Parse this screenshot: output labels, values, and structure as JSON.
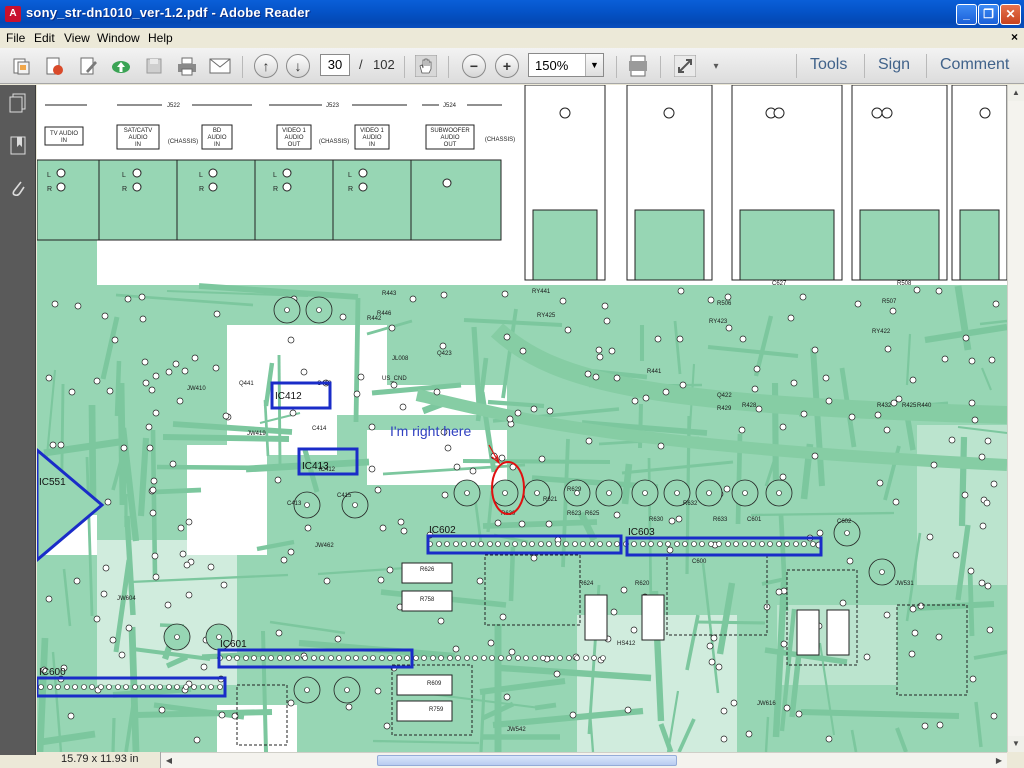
{
  "window": {
    "title": "sony_str-dn1010_ver-1.2.pdf - Adobe Reader",
    "app_icon": "adobe-pdf-icon",
    "minimize": "_",
    "maximize": "❐",
    "close": "✕"
  },
  "menu": {
    "items": [
      "File",
      "Edit",
      "View",
      "Window",
      "Help"
    ],
    "close_glyph": "×"
  },
  "toolbar": {
    "page_current": "30",
    "page_separator": "/",
    "page_total": "102",
    "zoom": "150%",
    "tools_label": "Tools",
    "sign_label": "Sign",
    "comment_label": "Comment"
  },
  "status": {
    "page_size": "15.79 x 11.93 in"
  },
  "colors": {
    "board_fill": "#97d6b4",
    "trace": "#8ccfa8",
    "highlight_box": "#1a2cc8",
    "annotation_red": "#e01010",
    "annotation_text": "#3040c0"
  },
  "schematic": {
    "jack_groups": [
      "J522",
      "J523",
      "J524"
    ],
    "jack_labels": [
      [
        "TV AUDIO",
        "IN"
      ],
      [
        "SAT/CATV",
        "AUDIO",
        "IN"
      ],
      [
        "BD",
        "AUDIO",
        "IN"
      ],
      [
        "VIDEO 1",
        "AUDIO",
        "OUT"
      ],
      [
        "VIDEO 1",
        "AUDIO",
        "IN"
      ],
      [
        "SUBWOOFER",
        "AUDIO",
        "OUT"
      ]
    ],
    "chassis_label": "(CHASSIS)",
    "lr_labels": [
      "L",
      "R"
    ],
    "annotation": "I'm right here",
    "ic_labels": [
      "IC551",
      "IC602",
      "IC603",
      "IC601",
      "IC600"
    ],
    "ic_box_labels": [
      "IC412",
      "IC413"
    ],
    "component_labels": [
      "RY441",
      "RY425",
      "RY423",
      "RY422",
      "C412",
      "C414",
      "C413",
      "C415",
      "IC412",
      "R626",
      "R758",
      "R609",
      "R759",
      "R624",
      "R620",
      "R621",
      "R623",
      "R625",
      "R629",
      "R639",
      "R630",
      "R632",
      "R633",
      "C601",
      "C602",
      "JW531",
      "JW419",
      "JW410",
      "JW462",
      "JW604",
      "JW542",
      "JW616",
      "HS412",
      "Q441",
      "Q423",
      "Q422",
      "R432",
      "R429",
      "R428",
      "R425",
      "R440",
      "R441",
      "R443",
      "R442",
      "R446",
      "JL008",
      "US_CND",
      "C600",
      "R507",
      "R506",
      "R508",
      "C627"
    ]
  }
}
